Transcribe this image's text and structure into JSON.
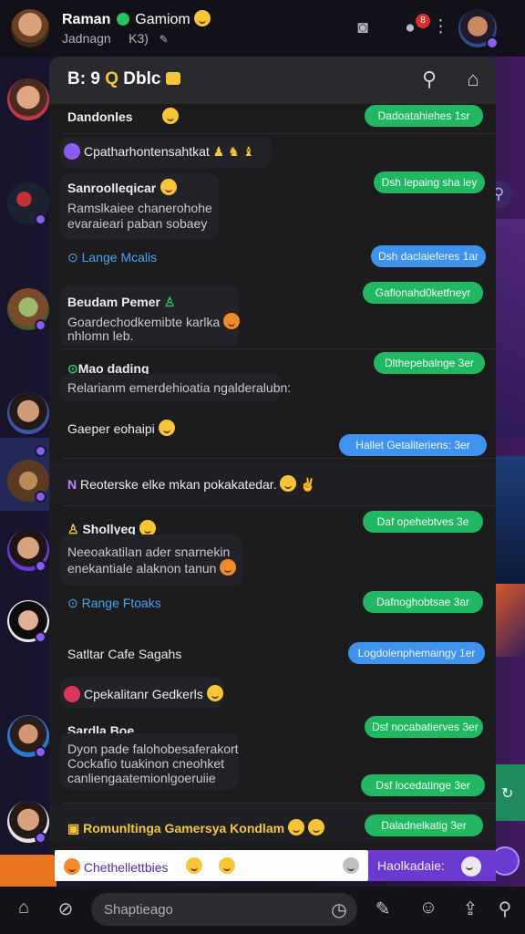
{
  "topbar": {
    "name": "Raman",
    "game": "Gamiom",
    "subtitle": "Jadnagn",
    "subtitle_extra": "K3)",
    "notification_count": "8"
  },
  "panel": {
    "title_left": "B: 9",
    "title_right": "Dblc"
  },
  "rows": {
    "r1_text": "Dandonles",
    "r1_bubble": "Dadoatahiehes 1sr",
    "r2_text": "Cpatharhontensahtkat",
    "r3_title": "Sanroolleqicar",
    "r3_line1": "Ramslkaiee chanerohohe",
    "r3_line2": "evaraieari paban sobaey",
    "r3_bubble": "Dsh lepaing sha ley",
    "r4_link": "Lange Mcalis",
    "r4_bubble": "Dsh daclaieferes 1ar",
    "r5_bubble": "Gaflonahd0ketfneyr",
    "r5_title": "Beudam Pemer",
    "r5_line1": "Goardechodkemibte karlka",
    "r5_line2": "nhlomn leb.",
    "r6_title": "Mao dading",
    "r6_bubble": "Dlthepebalnge 3er",
    "r6_line1": "Relarianm emerdehioatia ngalderalubn:",
    "r7_text": "Gaeper eohaipi",
    "r7_bubble": "Hallet Getaliteriens: 3er",
    "r8_text": "Reoterske elke mkan pokakatedar.",
    "r9_title": "Shollyeg",
    "r9_bubble": "Daf opehebtves 3e",
    "r9_line1": "Neeoakatilan ader snarnekin",
    "r9_line2": "enekantiale alaknon tanun",
    "r10_link": "Range Ftoaks",
    "r10_bubble": "Dafnoghobtsae 3ar",
    "r11_text": "Satltar Cafe Sagahs",
    "r11_bubble": "Logdolenphemaingy 1er",
    "r12_text": "Cpekalitanr Gedkerls",
    "r13_title": "Sardla Boe",
    "r13_bubble": "Dsf nocabatierves 3er",
    "r13_line1": "Dyon pade falohobesaferakort",
    "r13_line2": "Cockafio tuakinon cneohket",
    "r13_line3": "canliengaatemionlgoeruiie",
    "r14_bubble": "Dsf locedatinge 3er",
    "r15_text": "Romunltinga Gamersya Kondlam",
    "r15_bubble": "Daladnelkatig 3er"
  },
  "composer": {
    "white_label": "Chethellettbies",
    "purple_label": "Haolkadaie:"
  },
  "bottom": {
    "input_placeholder": "Shaptieago"
  },
  "colors": {
    "accent_green": "#22b763",
    "accent_blue": "#3f93ee",
    "accent_purple": "#6a3ad0",
    "panel_bg": "#1c1c1f"
  }
}
